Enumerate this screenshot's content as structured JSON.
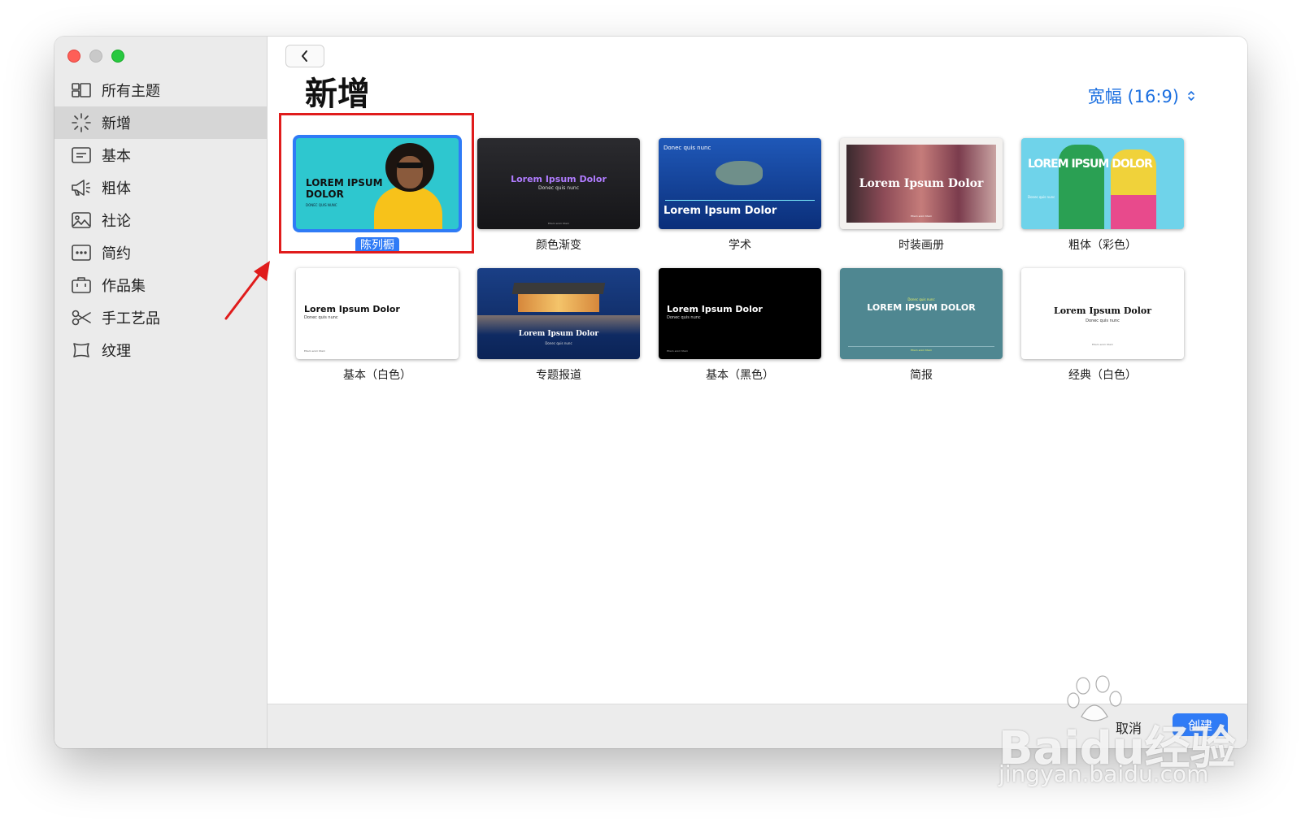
{
  "sidebar": {
    "items": [
      {
        "label": "所有主题",
        "icon": "grid-icon",
        "selected": false
      },
      {
        "label": "新增",
        "icon": "sparkle-icon",
        "selected": true
      },
      {
        "label": "基本",
        "icon": "text-box-icon",
        "selected": false
      },
      {
        "label": "粗体",
        "icon": "megaphone-icon",
        "selected": false
      },
      {
        "label": "社论",
        "icon": "photo-icon",
        "selected": false
      },
      {
        "label": "简约",
        "icon": "ellipsis-box-icon",
        "selected": false
      },
      {
        "label": "作品集",
        "icon": "briefcase-icon",
        "selected": false
      },
      {
        "label": "手工艺品",
        "icon": "scissors-icon",
        "selected": false
      },
      {
        "label": "纹理",
        "icon": "frame-icon",
        "selected": false
      }
    ]
  },
  "main": {
    "title": "新增",
    "aspect": "宽幅 (16:9)",
    "templates": [
      {
        "name": "陈列橱",
        "selected": true,
        "preview_text": "LOREM IPSUM DOLOR",
        "preview_sub": "DONEC QUIS NUNC"
      },
      {
        "name": "颜色渐变",
        "selected": false,
        "preview_text": "Lorem Ipsum Dolor",
        "preview_sub": "Donec quis nunc",
        "preview_foot": "Etiam enim titam"
      },
      {
        "name": "学术",
        "selected": false,
        "preview_text": "Lorem Ipsum Dolor",
        "preview_sub": "Donec quis nunc"
      },
      {
        "name": "时装画册",
        "selected": false,
        "preview_text": "Lorem Ipsum Dolor",
        "preview_sub": "Etiam enim titam"
      },
      {
        "name": "粗体（彩色）",
        "selected": false,
        "preview_text": "LOREM IPSUM DOLOR",
        "preview_sub": "Donec quis nunc"
      },
      {
        "name": "基本（白色）",
        "selected": false,
        "preview_text": "Lorem Ipsum Dolor",
        "preview_sub": "Donec quis nunc",
        "preview_foot": "Etiam enim titam"
      },
      {
        "name": "专题报道",
        "selected": false,
        "preview_text": "Lorem Ipsum Dolor",
        "preview_sub": "Donec quis nunc"
      },
      {
        "name": "基本（黑色）",
        "selected": false,
        "preview_text": "Lorem Ipsum Dolor",
        "preview_sub": "Donec quis nunc",
        "preview_foot": "Etiam enim titam"
      },
      {
        "name": "简报",
        "selected": false,
        "preview_text": "LOREM IPSUM DOLOR",
        "preview_sub": "Donec quis nunc",
        "preview_foot": "Etiam enim titam"
      },
      {
        "name": "经典（白色）",
        "selected": false,
        "preview_text": "Lorem Ipsum Dolor",
        "preview_sub": "Donec quis nunc",
        "preview_foot": "Etiam enim titam"
      }
    ]
  },
  "footer": {
    "cancel": "取消",
    "create": "创建"
  },
  "watermark": {
    "brand": "Baidu经验",
    "url": "jingyan.baidu.com"
  },
  "colors": {
    "accent": "#2f7bf6",
    "highlight": "#e01c1c",
    "sidebar_bg": "#ebebeb"
  }
}
